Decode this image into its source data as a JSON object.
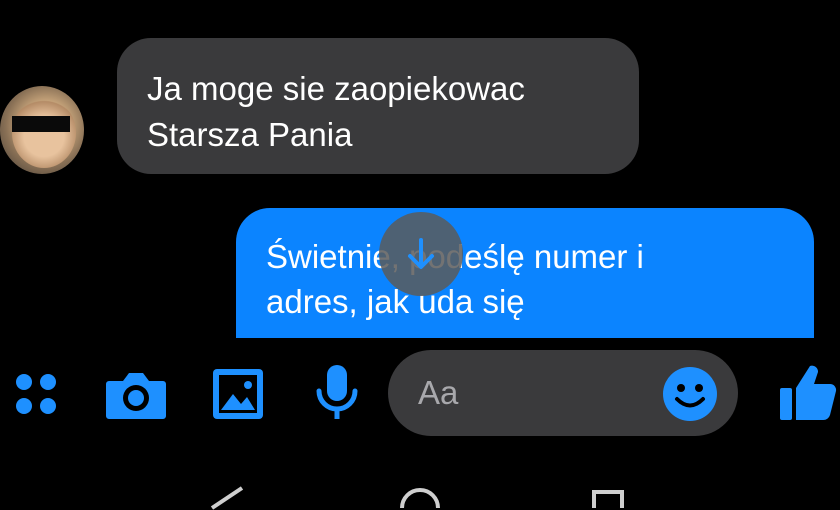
{
  "conversation": {
    "incoming": {
      "text_line1": "Ja moge sie zaopiekowac",
      "text_line2": "Starsza Pania"
    },
    "outgoing": {
      "text_line1": "Świetnie, podeślę numer i",
      "text_line2": "adres, jak uda się"
    }
  },
  "composer": {
    "placeholder": "Aa",
    "icons": [
      "apps-icon",
      "camera-icon",
      "gallery-icon",
      "microphone-icon",
      "emoji-icon",
      "thumbs-up-icon"
    ]
  },
  "colors": {
    "background": "#000000",
    "incoming_bubble": "#3a3a3c",
    "outgoing_bubble": "#0b84ff",
    "accent": "#1e90ff"
  }
}
